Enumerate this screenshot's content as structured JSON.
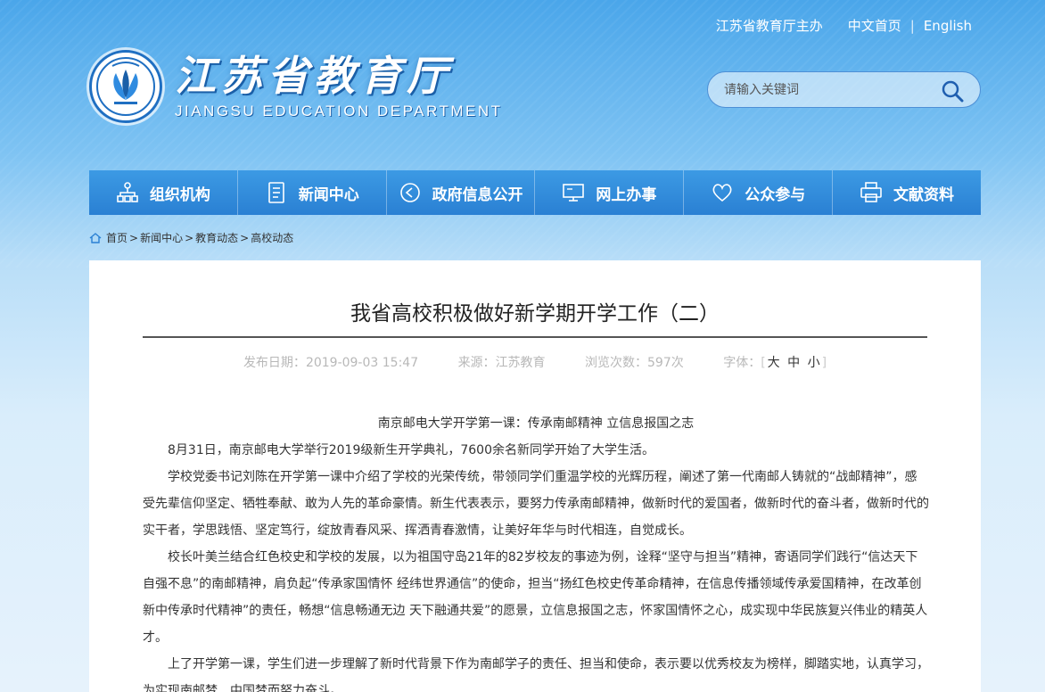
{
  "topbar": {
    "host": "江苏省教育厅主办",
    "home_cn": "中文首页",
    "separator": "|",
    "english": "English"
  },
  "logo": {
    "cn": "江苏省教育厅",
    "en": "JIANGSU EDUCATION DEPARTMENT"
  },
  "search": {
    "placeholder": "请输入关键词"
  },
  "nav": [
    {
      "label": "组织机构",
      "icon": "org-chart-icon"
    },
    {
      "label": "新闻中心",
      "icon": "document-icon"
    },
    {
      "label": "政府信息公开",
      "icon": "play-circle-icon"
    },
    {
      "label": "网上办事",
      "icon": "monitor-icon"
    },
    {
      "label": "公众参与",
      "icon": "heart-icon"
    },
    {
      "label": "文献资料",
      "icon": "printer-icon"
    }
  ],
  "breadcrumb": {
    "items": [
      "首页",
      "新闻中心",
      "教育动态",
      "高校动态"
    ],
    "sep": ">"
  },
  "article": {
    "title": "我省高校积极做好新学期开学工作（二）",
    "date_label": "发布日期：",
    "date": "2019-09-03 15:47",
    "source_label": "来源：",
    "source": "江苏教育",
    "views_label": "浏览次数：",
    "views": "597次",
    "font_label": "字体：",
    "font_large": "大",
    "font_medium": "中",
    "font_small": "小",
    "subtitle": "南京邮电大学开学第一课：传承南邮精神 立信息报国之志",
    "paragraphs": [
      "8月31日，南京邮电大学举行2019级新生开学典礼，7600余名新同学开始了大学生活。",
      "学校党委书记刘陈在开学第一课中介绍了学校的光荣传统，带领同学们重温学校的光辉历程，阐述了第一代南邮人铸就的“战邮精神”，感受先辈信仰坚定、牺牲奉献、敢为人先的革命豪情。新生代表表示，要努力传承南邮精神，做新时代的爱国者，做新时代的奋斗者，做新时代的实干者，学思践悟、坚定笃行，绽放青春风采、挥洒青春激情，让美好年华与时代相连，自觉成长。",
      "校长叶美兰结合红色校史和学校的发展，以为祖国守岛21年的82岁校友的事迹为例，诠释“坚守与担当”精神，寄语同学们践行“信达天下 自强不息”的南邮精神，肩负起“传承家国情怀 经纬世界通信”的使命，担当“扬红色校史传革命精神，在信息传播领域传承爱国精神，在改革创新中传承时代精神”的责任，畅想“信息畅通无边 天下融通共爱”的愿景，立信息报国之志，怀家国情怀之心，成实现中华民族复兴伟业的精英人才。",
      "上了开学第一课，学生们进一步理解了新时代背景下作为南邮学子的责任、担当和使命，表示要以优秀校友为榜样，脚踏实地，认真学习，为实现南邮梦、中国梦而努力奋斗。"
    ]
  }
}
